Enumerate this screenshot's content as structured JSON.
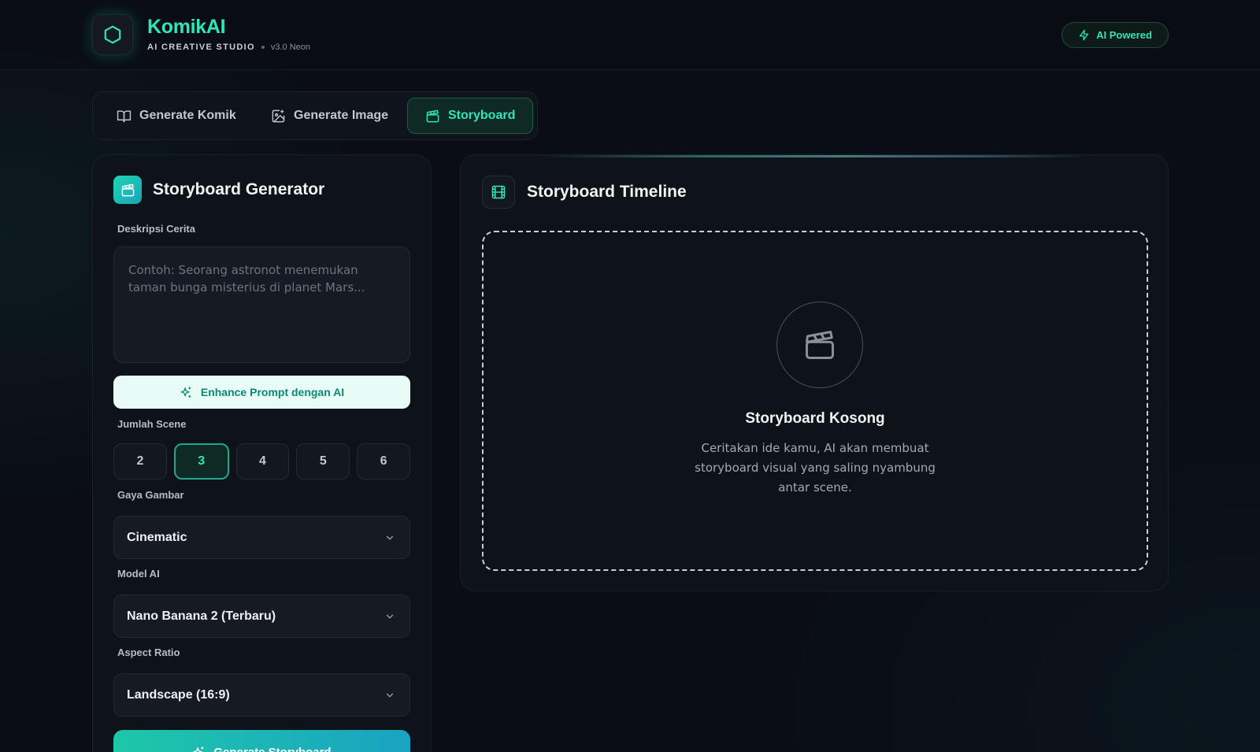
{
  "header": {
    "brand_name": "KomikAI",
    "brand_tagline": "AI CREATIVE STUDIO",
    "version": "v3.0 Neon",
    "badge_label": "AI Powered"
  },
  "tabs": [
    {
      "label": "Generate Komik",
      "icon": "book-open-icon",
      "active": false
    },
    {
      "label": "Generate Image",
      "icon": "image-sparkle-icon",
      "active": false
    },
    {
      "label": "Storyboard",
      "icon": "clapperboard-icon",
      "active": true
    }
  ],
  "generator": {
    "title": "Storyboard Generator",
    "description_label": "Deskripsi Cerita",
    "description_placeholder": "Contoh: Seorang astronot menemukan taman bunga misterius di planet Mars...",
    "enhance_label": "Enhance Prompt dengan AI",
    "scene_label": "Jumlah Scene",
    "scene_options": [
      "2",
      "3",
      "4",
      "5",
      "6"
    ],
    "scene_selected": "3",
    "style_label": "Gaya Gambar",
    "style_value": "Cinematic",
    "model_label": "Model AI",
    "model_value": "Nano Banana 2 (Terbaru)",
    "aspect_label": "Aspect Ratio",
    "aspect_value": "Landscape (16:9)",
    "generate_label": "Generate Storyboard"
  },
  "timeline": {
    "title": "Storyboard Timeline",
    "empty_title": "Storyboard Kosong",
    "empty_desc": "Ceritakan ide kamu, AI akan membuat storyboard visual yang saling nyambung antar scene."
  },
  "colors": {
    "accent": "#2ee6b8",
    "background": "#0a0d14",
    "panel": "#0e1219"
  }
}
